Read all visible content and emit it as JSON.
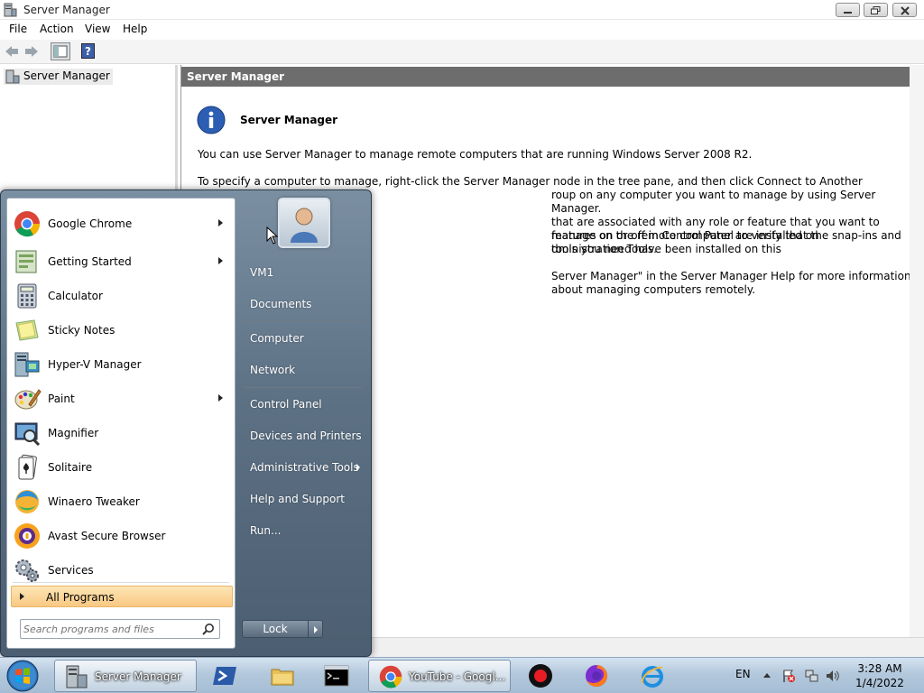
{
  "window": {
    "title": "Server Manager",
    "menu": [
      "File",
      "Action",
      "View",
      "Help"
    ]
  },
  "tree": {
    "root_label": "Server Manager"
  },
  "content": {
    "header": "Server Manager",
    "info_title": "Server Manager",
    "paragraphs": [
      "You can use Server Manager to manage remote computers that are running Windows Server 2008 R2.",
      "To specify a computer to manage, right-click the Server Manager node in the tree pane, and then click Connect to Another Computer.  You must",
      "roup on any computer you want to manage by using Server Manager.",
      "that are associated with any role or feature that you want to manage on the remote computer are installed on",
      "features on or off in Control Panel to verify that the snap-ins and tools you need have been installed on this",
      "dministration Tools.",
      "Server Manager\" in the Server Manager Help for more information about managing computers remotely."
    ]
  },
  "start_menu": {
    "programs": [
      {
        "label": "Google Chrome",
        "icon": "chrome-icon",
        "submenu": true
      },
      {
        "label": "Getting Started",
        "icon": "getting-started-icon",
        "submenu": true
      },
      {
        "label": "Calculator",
        "icon": "calculator-icon",
        "submenu": false
      },
      {
        "label": "Sticky Notes",
        "icon": "sticky-notes-icon",
        "submenu": false
      },
      {
        "label": "Hyper-V Manager",
        "icon": "hyper-v-icon",
        "submenu": false
      },
      {
        "label": "Paint",
        "icon": "paint-icon",
        "submenu": true
      },
      {
        "label": "Magnifier",
        "icon": "magnifier-icon",
        "submenu": false
      },
      {
        "label": "Solitaire",
        "icon": "solitaire-icon",
        "submenu": false
      },
      {
        "label": "Winaero Tweaker",
        "icon": "winaero-icon",
        "submenu": false
      },
      {
        "label": "Avast Secure Browser",
        "icon": "avast-icon",
        "submenu": false
      },
      {
        "label": "Services",
        "icon": "services-icon",
        "submenu": false
      }
    ],
    "all_programs": "All Programs",
    "search_placeholder": "Search programs and files",
    "right_items": [
      {
        "label": "VM1"
      },
      {
        "label": "Documents"
      },
      {
        "label": "Computer"
      },
      {
        "label": "Network"
      },
      {
        "label": "Control Panel"
      },
      {
        "label": "Devices and Printers"
      },
      {
        "label": "Administrative Tools",
        "submenu": true
      },
      {
        "label": "Help and Support"
      },
      {
        "label": "Run..."
      }
    ],
    "lock_label": "Lock"
  },
  "taskbar": {
    "server_manager": "Server Manager",
    "youtube": "YouTube - Googl...",
    "lang": "EN",
    "time": "3:28 AM",
    "date": "1/4/2022"
  },
  "colors": {
    "content_header_bg": "#6d6d6d",
    "all_programs_highlight": "#f9c882",
    "start_menu_bg": "#5d7185",
    "taskbar_bg": "#b3c8dc"
  }
}
